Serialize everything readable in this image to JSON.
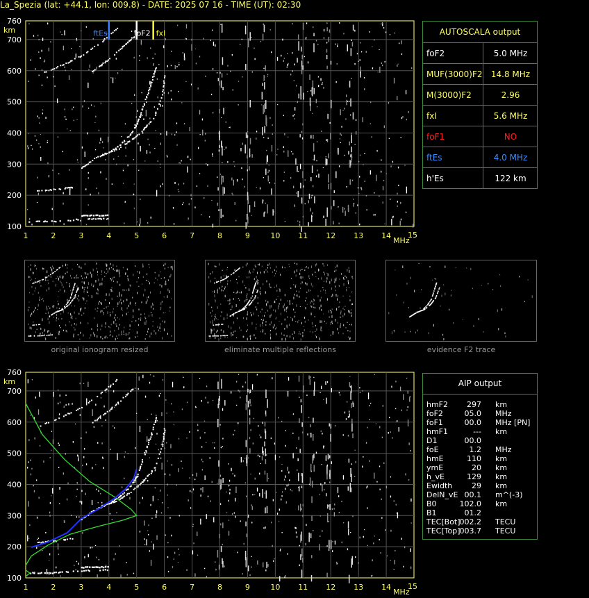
{
  "title": "La_Spezia (lat: +44.1, lon: 009.8) - DATE: 2025 07 16 - TIME (UT): 02:30",
  "plot": {
    "y_unit": "km",
    "x_unit": "MHz",
    "y_ticks": [
      "760",
      "700",
      "600",
      "500",
      "400",
      "300",
      "200",
      "100"
    ],
    "x_ticks": [
      "1",
      "2",
      "3",
      "4",
      "5",
      "6",
      "7",
      "8",
      "9",
      "10",
      "11",
      "12",
      "13",
      "14",
      "15"
    ],
    "markers": [
      {
        "label": "ftEs",
        "freq": 4.0,
        "color": "#3a7fff"
      },
      {
        "label": "foF2",
        "freq": 5.0,
        "color": "#ffffff"
      },
      {
        "label": "fxI",
        "freq": 5.6,
        "color": "#ffff33"
      }
    ]
  },
  "autoscala": {
    "title": "AUTOSCALA output",
    "rows": [
      {
        "key": "foF2",
        "value": "5.0 MHz",
        "key_color": "#ffffff",
        "value_color": "#ffffff"
      },
      {
        "key": "MUF(3000)F2",
        "value": "14.8 MHz",
        "key_color": "#ffff66",
        "value_color": "#ffff66"
      },
      {
        "key": "M(3000)F2",
        "value": "2.96",
        "key_color": "#ffff66",
        "value_color": "#ffff66"
      },
      {
        "key": "fxI",
        "value": "5.6 MHz",
        "key_color": "#ffff66",
        "value_color": "#ffff66"
      },
      {
        "key": "foF1",
        "value": "NO",
        "key_color": "#ff2020",
        "value_color": "#ff2020"
      },
      {
        "key": "ftEs",
        "value": "4.0 MHz",
        "key_color": "#3a8fff",
        "value_color": "#3a8fff"
      },
      {
        "key": "h'Es",
        "value": "122      km",
        "key_color": "#ffffff",
        "value_color": "#ffffff"
      }
    ]
  },
  "thumbnails": [
    {
      "caption": "original ionogram resized"
    },
    {
      "caption": "eliminate multiple reflections"
    },
    {
      "caption": "evidence F2 trace"
    }
  ],
  "aip": {
    "title": "AIP output",
    "rows": [
      {
        "k": "hmF2",
        "v": "297",
        "u": "km"
      },
      {
        "k": "foF2",
        "v": "05.0",
        "u": "MHz"
      },
      {
        "k": "foF1",
        "v": "00.0",
        "u": "MHz    [PN]"
      },
      {
        "k": "hmF1",
        "v": "---",
        "u": "km"
      },
      {
        "k": "D1",
        "v": "00.0",
        "u": ""
      },
      {
        "k": "foE",
        "v": "1.2",
        "u": "MHz"
      },
      {
        "k": "hmE",
        "v": "110",
        "u": "km"
      },
      {
        "k": "ymE",
        "v": "20",
        "u": "km"
      },
      {
        "k": "h_vE",
        "v": "129",
        "u": "km"
      },
      {
        "k": "Ewidth",
        "v": "29",
        "u": "km"
      },
      {
        "k": "DelN_vE",
        "v": "00.1",
        "u": "m^(-3)"
      },
      {
        "k": "B0",
        "v": "102.0",
        "u": "km"
      },
      {
        "k": "B1",
        "v": "01.2",
        "u": ""
      },
      {
        "k": "TEC[Bot]",
        "v": "002.2",
        "u": "TECU"
      },
      {
        "k": "TEC[Top]",
        "v": "003.7",
        "u": "TECU"
      }
    ]
  }
}
